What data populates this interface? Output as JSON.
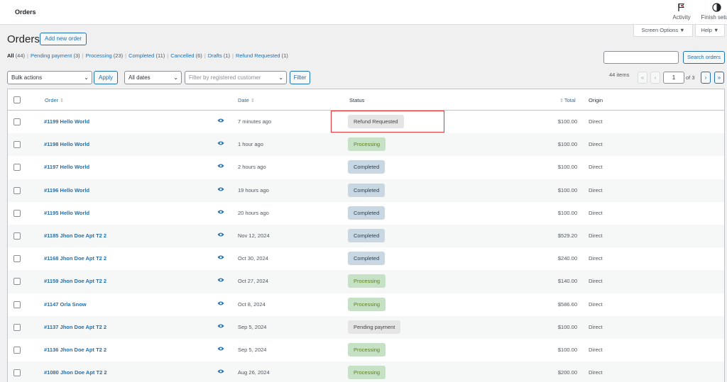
{
  "topbar": {
    "title": "Orders",
    "activity_label": "Activity",
    "finish_label": "Finish setup"
  },
  "tabs": {
    "screen_options": "Screen Options ▼",
    "help": "Help ▼"
  },
  "page": {
    "heading": "Orders",
    "add_new": "Add new order"
  },
  "filters_links": [
    {
      "label": "All",
      "count": "(44)",
      "current": true
    },
    {
      "label": "Pending payment",
      "count": "(3)"
    },
    {
      "label": "Processing",
      "count": "(23)"
    },
    {
      "label": "Completed",
      "count": "(11)"
    },
    {
      "label": "Cancelled",
      "count": "(6)"
    },
    {
      "label": "Drafts",
      "count": "(1)"
    },
    {
      "label": "Refund Requested",
      "count": "(1)"
    }
  ],
  "search": {
    "button": "Search orders",
    "value": ""
  },
  "toolbar": {
    "bulk_actions": "Bulk actions",
    "apply": "Apply",
    "all_dates": "All dates",
    "customer_placeholder": "Filter by registered customer",
    "filter": "Filter"
  },
  "pagination": {
    "items": "44 items",
    "first": "«",
    "prev": "‹",
    "current": "1",
    "of": "of 3",
    "next": "›",
    "last": "»"
  },
  "table": {
    "headers": {
      "order": "Order",
      "date": "Date",
      "status": "Status",
      "total": "Total",
      "origin": "Origin"
    },
    "rows": [
      {
        "order": "#1199 Hello World",
        "date": "7 minutes ago",
        "status": "Refund Requested",
        "kind": "refund",
        "total": "$100.00",
        "origin": "Direct"
      },
      {
        "order": "#1198 Hello World",
        "date": "1 hour ago",
        "status": "Processing",
        "kind": "processing",
        "total": "$100.00",
        "origin": "Direct"
      },
      {
        "order": "#1197 Hello World",
        "date": "2 hours ago",
        "status": "Completed",
        "kind": "completed",
        "total": "$100.00",
        "origin": "Direct"
      },
      {
        "order": "#1196 Hello World",
        "date": "19 hours ago",
        "status": "Completed",
        "kind": "completed",
        "total": "$100.00",
        "origin": "Direct"
      },
      {
        "order": "#1195 Hello World",
        "date": "20 hours ago",
        "status": "Completed",
        "kind": "completed",
        "total": "$100.00",
        "origin": "Direct"
      },
      {
        "order": "#1185 Jhon Doe Apt T2 2",
        "date": "Nov 12, 2024",
        "status": "Completed",
        "kind": "completed",
        "total": "$529.20",
        "origin": "Direct"
      },
      {
        "order": "#1168 Jhon Doe Apt T2 2",
        "date": "Oct 30, 2024",
        "status": "Completed",
        "kind": "completed",
        "total": "$240.00",
        "origin": "Direct"
      },
      {
        "order": "#1159 Jhon Doe Apt T2 2",
        "date": "Oct 27, 2024",
        "status": "Processing",
        "kind": "processing",
        "total": "$140.00",
        "origin": "Direct"
      },
      {
        "order": "#1147 Orla Snow",
        "date": "Oct 8, 2024",
        "status": "Processing",
        "kind": "processing",
        "total": "$586.60",
        "origin": "Direct"
      },
      {
        "order": "#1137 Jhon Doe Apt T2 2",
        "date": "Sep 5, 2024",
        "status": "Pending payment",
        "kind": "pending",
        "total": "$100.00",
        "origin": "Direct"
      },
      {
        "order": "#1136 Jhon Doe Apt T2 2",
        "date": "Sep 5, 2024",
        "status": "Processing",
        "kind": "processing",
        "total": "$100.00",
        "origin": "Direct"
      },
      {
        "order": "#1080 Jhon Doe Apt T2 2",
        "date": "Aug 26, 2024",
        "status": "Processing",
        "kind": "processing",
        "total": "$200.00",
        "origin": "Direct"
      }
    ]
  },
  "colors": {
    "accent": "#2271b1",
    "highlight": "#ee3333"
  },
  "icons": {
    "activity": "flag-icon",
    "finish": "half-circle-icon",
    "preview": "eye-icon"
  }
}
